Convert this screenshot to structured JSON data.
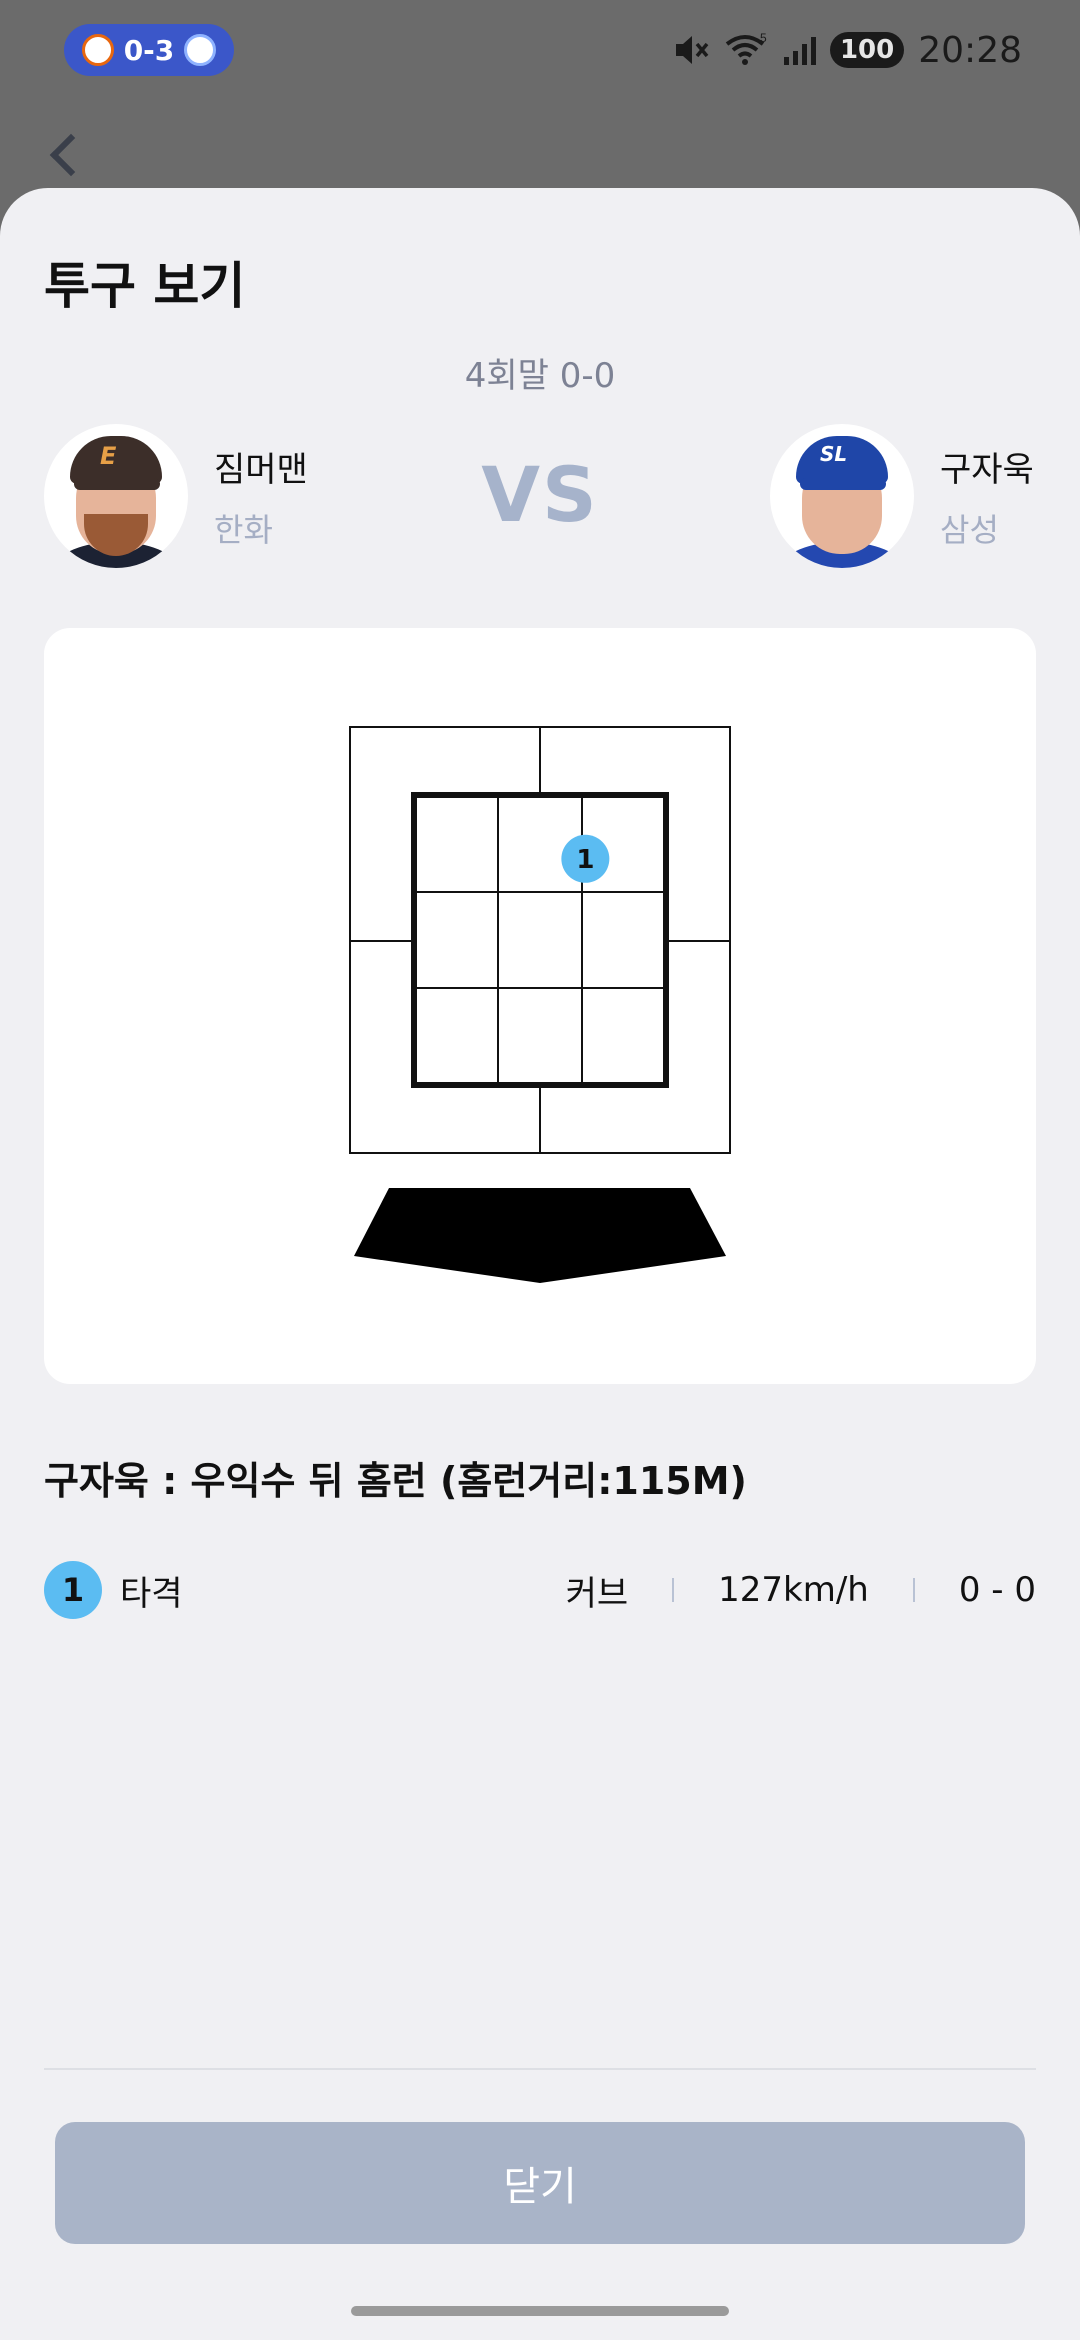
{
  "status_bar": {
    "score": "0-3",
    "away_logo": "Eagles",
    "home_logo": "Lions",
    "battery": "100",
    "time": "20:28",
    "icons": [
      "mute-icon",
      "wifi-icon",
      "signal-icon"
    ],
    "wifi_badge": "5"
  },
  "sheet": {
    "title": "투구 보기",
    "inning": "4회말 0-0",
    "vs_label": "VS"
  },
  "pitcher": {
    "name": "짐머맨",
    "team": "한화",
    "cap_mark": "E"
  },
  "batter": {
    "name": "구자욱",
    "team": "삼성",
    "cap_mark": "SL"
  },
  "pitch_zone": {
    "pitches": [
      {
        "number": "1",
        "row": 0.22,
        "col": 0.68
      }
    ]
  },
  "result": {
    "text": "구자욱 : 우익수 뒤 홈런 (홈런거리:115M)"
  },
  "pitch_list": [
    {
      "number": "1",
      "result": "타격",
      "type": "커브",
      "speed": "127km/h",
      "count": "0 - 0"
    }
  ],
  "footer": {
    "close_label": "닫기"
  },
  "colors": {
    "accent": "#5bbcf2",
    "button": "#a9b4c8",
    "vs": "#a6b3cb"
  }
}
